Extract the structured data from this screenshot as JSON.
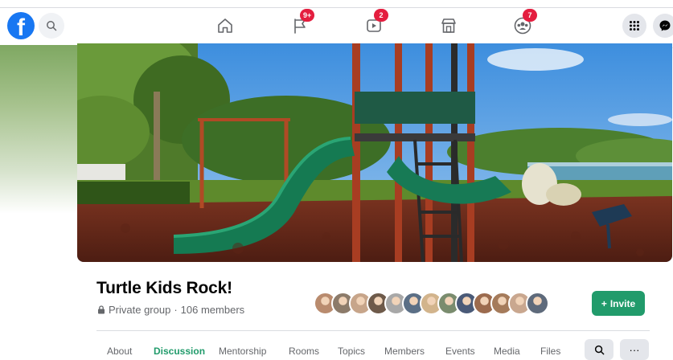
{
  "nav": {
    "badges": {
      "pages": "9+",
      "watch": "2",
      "groups": "7"
    },
    "icons": [
      "facebook-logo",
      "search-icon",
      "home-icon",
      "pages-icon",
      "watch-icon",
      "marketplace-icon",
      "groups-icon",
      "menu-grid-icon",
      "messenger-icon"
    ]
  },
  "group": {
    "name": "Turtle Kids Rock!",
    "privacy": "Private group",
    "separator": " · ",
    "members": "106 members",
    "invite_label": "Invite",
    "invite_plus": "+"
  },
  "avatar_colors": [
    "#b98b6e",
    "#8c7b6a",
    "#c7a58a",
    "#6e5a4a",
    "#a8a8a8",
    "#5b6f86",
    "#d2b48c",
    "#7a8c6e",
    "#4a5a78",
    "#9c6b4e",
    "#a57b5b",
    "#c9a78f",
    "#5e6a7b"
  ],
  "tabs": [
    "About",
    "Discussion",
    "Mentorship",
    "Rooms",
    "Topics",
    "Members",
    "Events",
    "Media",
    "Files"
  ],
  "active_tab": "Discussion",
  "tab_buttons": {
    "search": "search-icon",
    "more": "···"
  },
  "colors": {
    "brand": "#1877f2",
    "accent": "#219b6b",
    "badge": "#e41e3f"
  }
}
